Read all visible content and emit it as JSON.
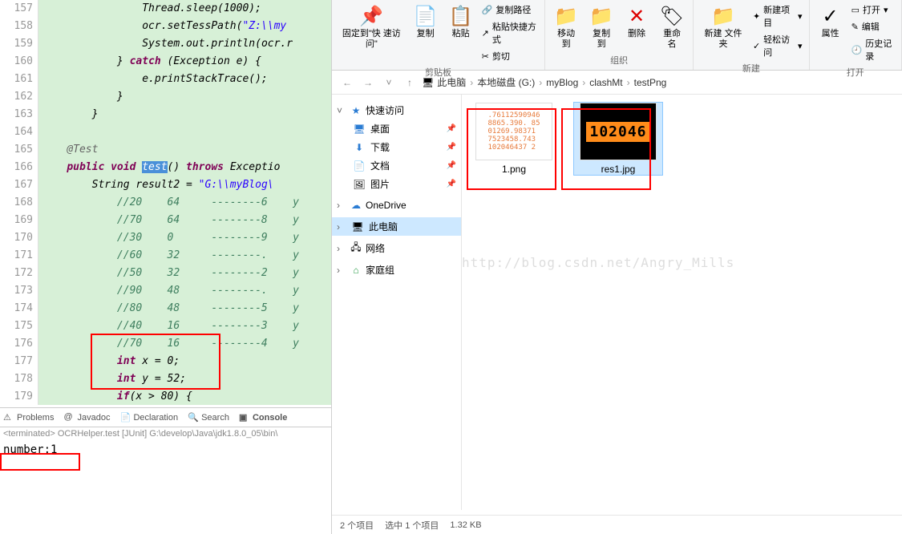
{
  "editor": {
    "lines": [
      {
        "n": 157,
        "html": "                Thread.sleep(<span class='type'>1000</span>);"
      },
      {
        "n": 158,
        "html": "                ocr.setTessPath(<span class='str'>\"Z:\\\\my</span>"
      },
      {
        "n": 159,
        "html": "                System.<span class='type'>out</span>.println(ocr.<span class='type'>r</span>"
      },
      {
        "n": 160,
        "html": "            } <span class='kw'>catch</span> (Exception e) {"
      },
      {
        "n": 161,
        "html": "                e.printStackTrace();"
      },
      {
        "n": 162,
        "html": "            }"
      },
      {
        "n": 163,
        "html": "        }"
      },
      {
        "n": 164,
        "html": ""
      },
      {
        "n": 165,
        "html": "    <span class='ann'>@Test</span>"
      },
      {
        "n": 166,
        "html": "    <span class='kw'>public void</span> <span class='sel'>test</span>() <span class='kw'>throws</span> Exceptio"
      },
      {
        "n": 167,
        "html": "        String result2 = <span class='str'>\"G:\\\\myBlog\\</span>"
      },
      {
        "n": 168,
        "html": "            <span class='cmt'>//20    64     --------6    y</span>"
      },
      {
        "n": 169,
        "html": "            <span class='cmt'>//70    64     --------8    y</span>"
      },
      {
        "n": 170,
        "html": "            <span class='cmt'>//30    0      --------9    y</span>"
      },
      {
        "n": 171,
        "html": "            <span class='cmt'>//60    32     --------.    y</span>"
      },
      {
        "n": 172,
        "html": "            <span class='cmt'>//50    32     --------2    y</span>"
      },
      {
        "n": 173,
        "html": "            <span class='cmt'>//90    48     --------.    y</span>"
      },
      {
        "n": 174,
        "html": "            <span class='cmt'>//80    48     --------5    y</span>"
      },
      {
        "n": 175,
        "html": "            <span class='cmt'>//40    16     --------3    y</span>"
      },
      {
        "n": 176,
        "html": "            <span class='cmt'>//70    16     --------4    y</span>"
      },
      {
        "n": 177,
        "html": "            <span class='kw'>int</span> x = 0;"
      },
      {
        "n": 178,
        "html": "            <span class='kw'>int</span> y = 52;"
      },
      {
        "n": 179,
        "html": "            <span class='kw'>if</span>(x > 80) {"
      }
    ]
  },
  "console": {
    "tabs": {
      "problems": "Problems",
      "javadoc": "Javadoc",
      "declaration": "Declaration",
      "search": "Search",
      "console": "Console"
    },
    "terminated": "<terminated> OCRHelper.test [JUnit] G:\\develop\\Java\\jdk1.8.0_05\\bin\\",
    "output": "number:1"
  },
  "ribbon": {
    "pin": {
      "label": "固定到\"快\n速访问\""
    },
    "copy": "复制",
    "paste": "粘贴",
    "copy_path": "复制路径",
    "paste_shortcut": "粘贴快捷方式",
    "cut": "剪切",
    "group_clipboard": "剪贴板",
    "move_to": "移动到",
    "copy_to": "复制到",
    "delete": "删除",
    "rename": "重命名",
    "group_organize": "组织",
    "new_folder": "新建\n文件夹",
    "new_item": "新建项目",
    "easy_access": "轻松访问",
    "group_new": "新建",
    "properties": "属性",
    "open": "打开",
    "edit": "编辑",
    "history": "历史记录",
    "group_open": "打开"
  },
  "breadcrumb": {
    "items": [
      "此电脑",
      "本地磁盘 (G:)",
      "myBlog",
      "clashMt",
      "testPng"
    ]
  },
  "sidebar": {
    "quick_access": "快速访问",
    "desktop": "桌面",
    "downloads": "下载",
    "documents": "文档",
    "pictures": "图片",
    "onedrive": "OneDrive",
    "this_pc": "此电脑",
    "network": "网络",
    "homegroup": "家庭组"
  },
  "files": {
    "png": {
      "name": "1.png",
      "preview": ".76112590946\n8865.390. 85\n01269.98371\n7523458.743\n102046437 2"
    },
    "jpg": {
      "name": "res1.jpg",
      "preview": "102046"
    }
  },
  "status": {
    "count": "2 个项目",
    "selected": "选中 1 个项目",
    "size": "1.32 KB"
  },
  "watermark": "http://blog.csdn.net/Angry_Mills"
}
